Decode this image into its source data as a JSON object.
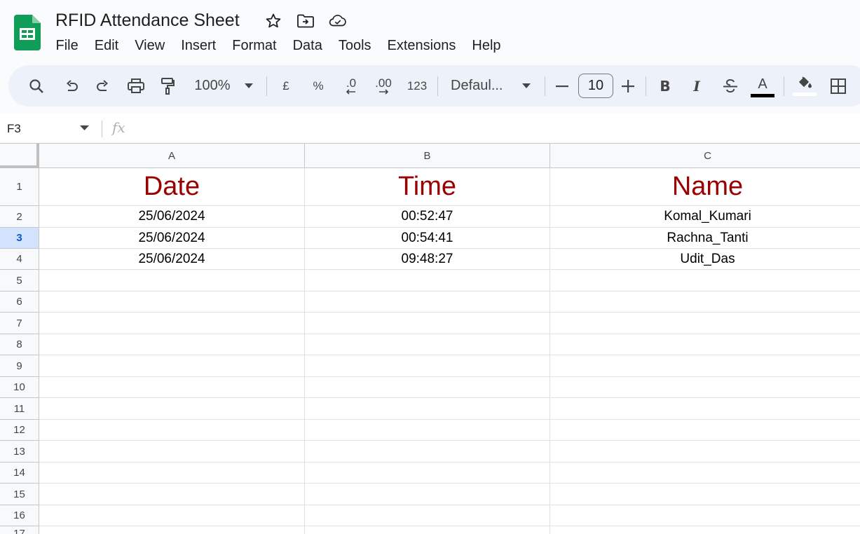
{
  "document": {
    "title": "RFID Attendance Sheet"
  },
  "menu": [
    "File",
    "Edit",
    "View",
    "Insert",
    "Format",
    "Data",
    "Tools",
    "Extensions",
    "Help"
  ],
  "toolbar": {
    "zoom": "100%",
    "currency": "£",
    "percent": "%",
    "decrease_decimal": ".0",
    "increase_decimal": ".00",
    "number_format": "123",
    "font_name": "Defaul...",
    "font_size": "10",
    "bold": "B",
    "italic": "I",
    "text_color_letter": "A",
    "text_color": "#000000"
  },
  "formula_bar": {
    "cell_ref": "F3",
    "fx": "fx",
    "value": ""
  },
  "colors": {
    "header_text": "#990000",
    "active_row": "#d3e3fd",
    "sheets_green": "#0f9d58"
  },
  "sheet": {
    "columns": [
      "A",
      "B",
      "C"
    ],
    "row_numbers": [
      "1",
      "2",
      "3",
      "4",
      "5",
      "6",
      "7",
      "8",
      "9",
      "10",
      "11",
      "12",
      "13",
      "14",
      "15",
      "16",
      "17"
    ],
    "active_row": "3",
    "header_row": [
      "Date",
      "Time",
      "Name"
    ],
    "rows": [
      [
        "25/06/2024",
        "00:52:47",
        "Komal_Kumari"
      ],
      [
        "25/06/2024",
        "00:54:41",
        "Rachna_Tanti"
      ],
      [
        "25/06/2024",
        "09:48:27",
        "Udit_Das"
      ]
    ]
  }
}
